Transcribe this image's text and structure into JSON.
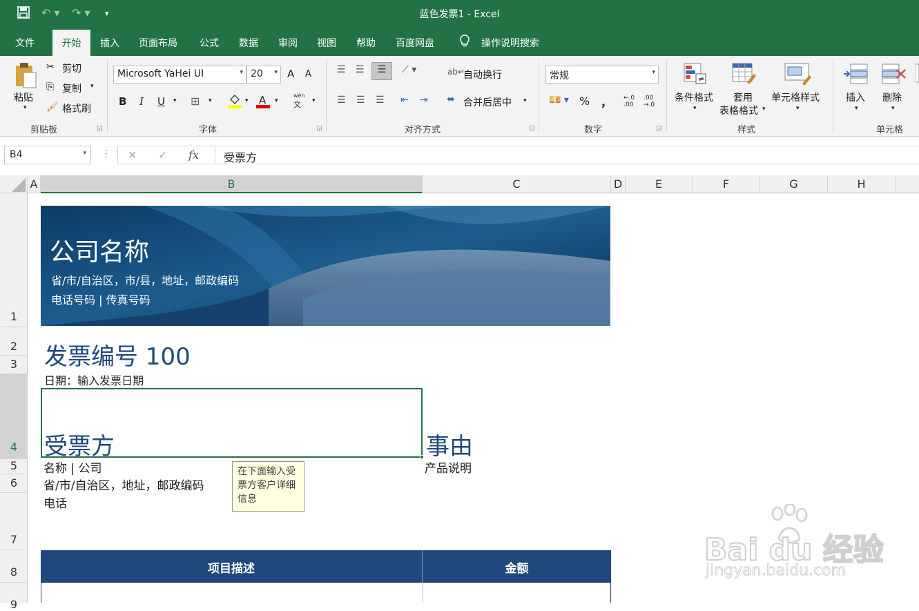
{
  "app": {
    "title": "蓝色发票1  -  Excel"
  },
  "menu": {
    "items": [
      "文件",
      "开始",
      "插入",
      "页面布局",
      "公式",
      "数据",
      "审阅",
      "视图",
      "帮助",
      "百度网盘"
    ],
    "active": "开始",
    "search_label": "操作说明搜索"
  },
  "ribbon": {
    "clipboard": {
      "paste": "粘贴",
      "cut": "剪切",
      "copy": "复制",
      "format_painter": "格式刷",
      "label": "剪贴板"
    },
    "font": {
      "name": "Microsoft YaHei UI",
      "size": "20",
      "bold": "B",
      "italic": "I",
      "underline": "U",
      "grow": "A",
      "shrink": "A",
      "label": "字体",
      "wen": "文"
    },
    "alignment": {
      "wrap": "自动换行",
      "merge": "合并后居中",
      "label": "对齐方式"
    },
    "number": {
      "format": "常规",
      "percent": "%",
      "comma": "，",
      "inc_dec": ".0 .00",
      "dec_dec": ".00 .0",
      "label": "数字"
    },
    "styles": {
      "conditional": "条件格式",
      "table_fmt_1": "套用",
      "table_fmt_2": "表格格式",
      "cell_styles": "单元格样式",
      "label": "样式"
    },
    "cells": {
      "insert": "插入",
      "delete": "删除",
      "label": "单元格"
    }
  },
  "formula_bar": {
    "name_box": "B4",
    "cancel": "✕",
    "enter": "✓",
    "fx": "fx",
    "content": "受票方"
  },
  "columns": [
    "A",
    "B",
    "C",
    "D",
    "E",
    "F",
    "G",
    "H"
  ],
  "rows": [
    "1",
    "2",
    "3",
    "4",
    "5",
    "6",
    "7",
    "8",
    "9"
  ],
  "sheet": {
    "company_name": "公司名称",
    "company_address": "省/市/自治区，市/县，地址，邮政编码",
    "company_phone": "电话号码 | 传真号码",
    "invoice_no": "发票编号 100",
    "date": "日期：输入发票日期",
    "bill_to": "受票方",
    "for_label": "事由",
    "client_name": "名称 | 公司",
    "client_address": "省/市/自治区，地址，邮政编码",
    "client_phone": "电话",
    "product_desc": "产品说明",
    "tooltip": "在下面输入受票方客户详细信息",
    "table_header_desc": "项目描述",
    "table_header_amount": "金额"
  },
  "watermark": {
    "text": "Bai du 经验",
    "url": "jingyan.baidu.com"
  },
  "colors": {
    "excel_green": "#217346",
    "invoice_blue": "#1f497d",
    "header_fill": "#1f497d"
  }
}
